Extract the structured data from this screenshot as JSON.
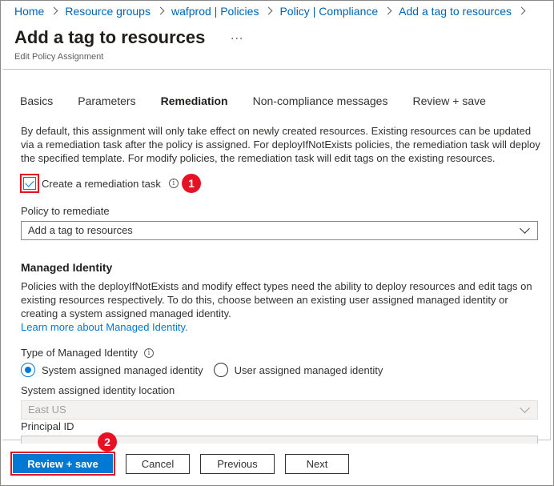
{
  "breadcrumb": {
    "items": [
      {
        "label": "Home"
      },
      {
        "label": "Resource groups"
      },
      {
        "label": "wafprod | Policies"
      },
      {
        "label": "Policy | Compliance"
      },
      {
        "label": "Add a tag to resources"
      }
    ]
  },
  "header": {
    "title": "Add a tag to resources",
    "more": "...",
    "subtitle": "Edit Policy Assignment"
  },
  "tabs": [
    {
      "label": "Basics",
      "active": false
    },
    {
      "label": "Parameters",
      "active": false
    },
    {
      "label": "Remediation",
      "active": true
    },
    {
      "label": "Non-compliance messages",
      "active": false
    },
    {
      "label": "Review + save",
      "active": false
    }
  ],
  "remediation": {
    "description": "By default, this assignment will only take effect on newly created resources. Existing resources can be updated via a remediation task after the policy is assigned. For deployIfNotExists policies, the remediation task will deploy the specified template. For modify policies, the remediation task will edit tags on the existing resources.",
    "create_task_label": "Create a remediation task",
    "create_task_checked": true,
    "policy_label": "Policy to remediate",
    "policy_value": "Add a tag to resources"
  },
  "managed_identity": {
    "title": "Managed Identity",
    "description": "Policies with the deployIfNotExists and modify effect types need the ability to deploy resources and edit tags on existing resources respectively. To do this, choose between an existing user assigned managed identity or creating a system assigned managed identity.",
    "learn_more": "Learn more about Managed Identity.",
    "type_label": "Type of Managed Identity",
    "options": [
      {
        "label": "System assigned managed identity",
        "selected": true
      },
      {
        "label": "User assigned managed identity",
        "selected": false
      }
    ],
    "location_label": "System assigned identity location",
    "location_value": "East US",
    "principal_label": "Principal ID"
  },
  "annotations": {
    "badge1": "1",
    "badge2": "2",
    "highlight_color": "#e81123"
  },
  "footer": {
    "review_save": "Review + save",
    "cancel": "Cancel",
    "previous": "Previous",
    "next": "Next"
  },
  "colors": {
    "accent": "#0078d4",
    "link": "#0063b1"
  },
  "icons": {
    "breadcrumb_separator": "chevron-right-icon",
    "info": "info-icon",
    "dropdown": "chevron-down-icon",
    "checkbox": "checkmark-icon"
  }
}
